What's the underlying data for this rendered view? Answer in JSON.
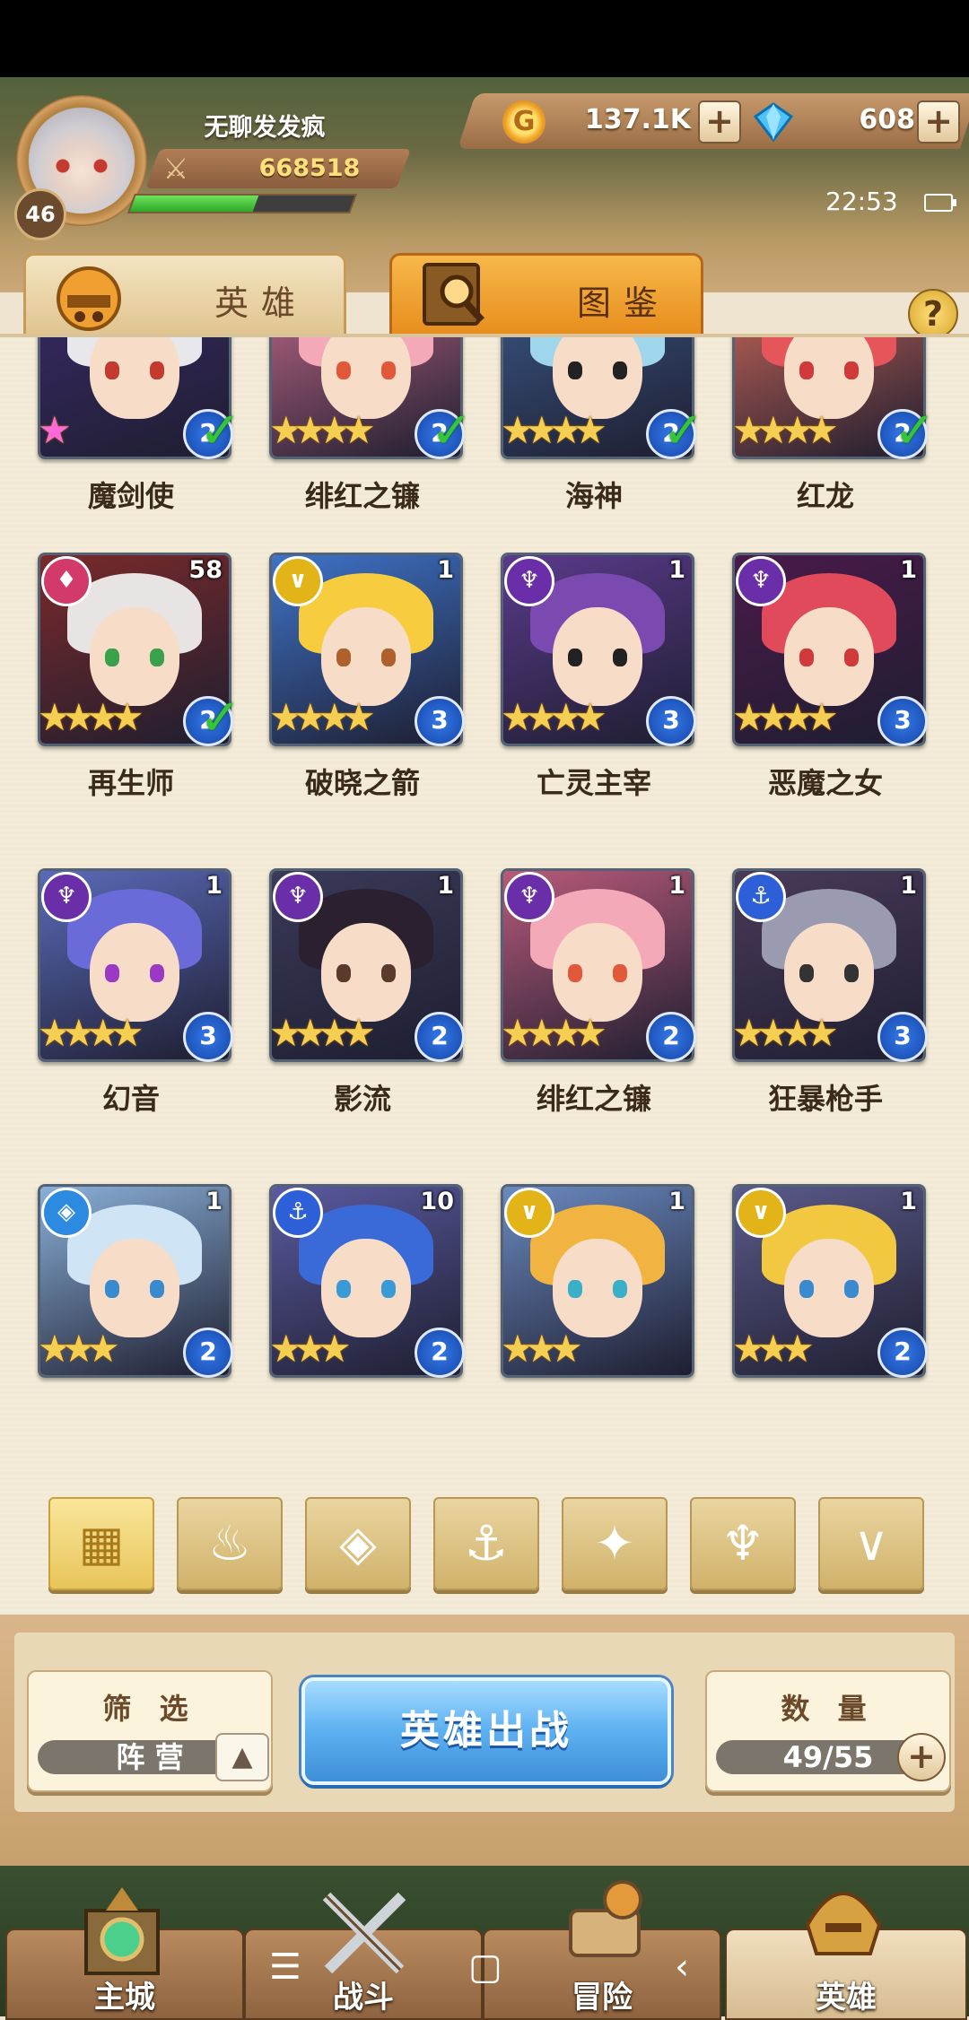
{
  "player": {
    "name": "无聊发发疯",
    "level": "46",
    "power": "668518",
    "exp_fraction": 0.56
  },
  "resources": {
    "gold": "137.1K",
    "gems": "608"
  },
  "status": {
    "time": "22:53"
  },
  "tabs": [
    {
      "label": "英雄"
    },
    {
      "label": "图鉴"
    }
  ],
  "help": "?",
  "heroes": [
    {
      "name": "魔剑使",
      "stars": 0,
      "rainbow": true,
      "class": "2",
      "check": true,
      "faction": "",
      "count": ""
    },
    {
      "name": "绯红之镰",
      "stars": 4,
      "class": "2",
      "check": true,
      "faction": "",
      "count": ""
    },
    {
      "name": "海神",
      "stars": 4,
      "class": "2",
      "check": true,
      "faction": "",
      "count": ""
    },
    {
      "name": "红龙",
      "stars": 4,
      "class": "2",
      "check": true,
      "faction": "",
      "count": ""
    },
    {
      "name": "再生师",
      "stars": 4,
      "class": "2",
      "check": true,
      "faction": "flame",
      "count": "58"
    },
    {
      "name": "破晓之箭",
      "stars": 4,
      "class": "3",
      "check": false,
      "faction": "light",
      "count": "1"
    },
    {
      "name": "亡灵主宰",
      "stars": 4,
      "class": "3",
      "check": false,
      "faction": "dark",
      "count": "1"
    },
    {
      "name": "恶魔之女",
      "stars": 4,
      "class": "3",
      "check": false,
      "faction": "dark",
      "count": "1"
    },
    {
      "name": "幻音",
      "stars": 4,
      "class": "3",
      "check": false,
      "faction": "dark",
      "count": "1"
    },
    {
      "name": "影流",
      "stars": 4,
      "class": "2",
      "check": false,
      "faction": "dark",
      "count": "1"
    },
    {
      "name": "绯红之镰",
      "stars": 4,
      "class": "2",
      "check": false,
      "faction": "dark",
      "count": "1"
    },
    {
      "name": "狂暴枪手",
      "stars": 4,
      "class": "3",
      "check": false,
      "faction": "anchor",
      "count": "1"
    },
    {
      "name": "",
      "stars": 3,
      "class": "2",
      "check": false,
      "faction": "ice",
      "count": "1"
    },
    {
      "name": "",
      "stars": 3,
      "class": "2",
      "check": false,
      "faction": "anchor",
      "count": "10"
    },
    {
      "name": "",
      "stars": 3,
      "class": "",
      "check": false,
      "faction": "light",
      "count": "1"
    },
    {
      "name": "",
      "stars": 3,
      "class": "2",
      "check": false,
      "faction": "light",
      "count": "1"
    }
  ],
  "filters": [
    {
      "icon": "grid-all-icon"
    },
    {
      "icon": "flame-faction-icon"
    },
    {
      "icon": "ice-faction-icon"
    },
    {
      "icon": "anchor-faction-icon"
    },
    {
      "icon": "beast-faction-icon"
    },
    {
      "icon": "dark-faction-icon"
    },
    {
      "icon": "light-faction-icon"
    }
  ],
  "filter_box": {
    "title": "筛 选",
    "value": "阵 营"
  },
  "deploy": {
    "label": "英雄出战"
  },
  "count_box": {
    "title": "数 量",
    "value": "49/55"
  },
  "nav": [
    {
      "label": "主城"
    },
    {
      "label": "战斗"
    },
    {
      "label": "冒险"
    },
    {
      "label": "英雄"
    }
  ],
  "colors": {
    "flame": "#d23a6a",
    "light": "#e3b418",
    "dark": "#6a2fa8",
    "anchor": "#2c5fd8",
    "ice": "#2c8ae0"
  }
}
